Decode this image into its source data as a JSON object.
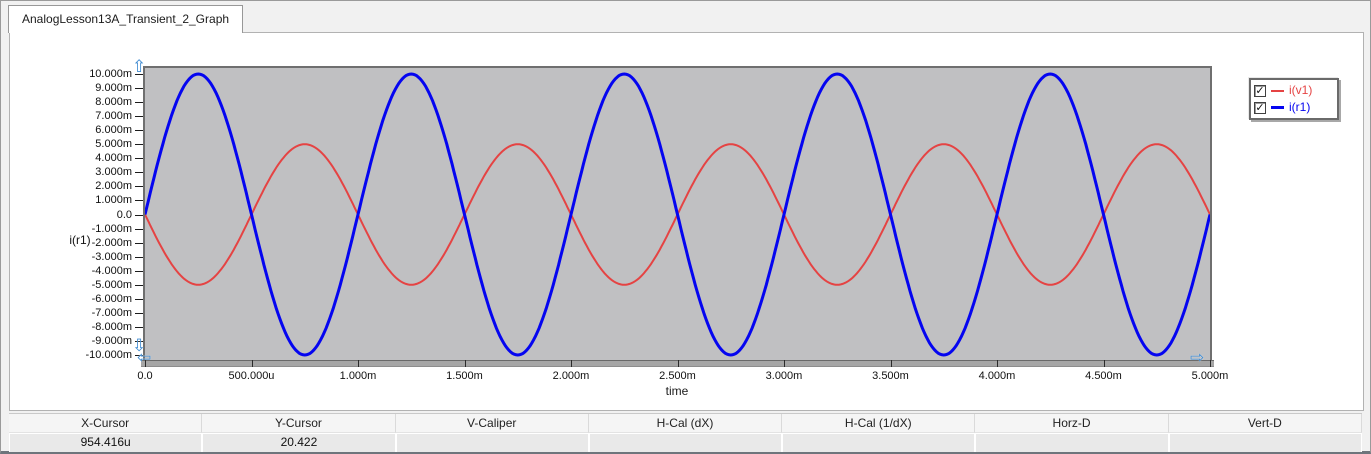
{
  "window": {
    "tab_title": "AnalogLesson13A_Transient_2_Graph"
  },
  "icons": {
    "pan_up": "⇧",
    "pan_down": "⇩",
    "pan_left": "⇦",
    "pan_right": "⇨",
    "checkmark": "✓"
  },
  "chart_data": {
    "type": "line",
    "title": "",
    "xlabel": "time",
    "ylabel": "i(r1)",
    "xlim": [
      0,
      0.005
    ],
    "ylim": [
      -0.01,
      0.01
    ],
    "grid": false,
    "plot_bg": "#c0c0c2",
    "x_ticks": [
      0,
      0.0005,
      0.001,
      0.0015,
      0.002,
      0.0025,
      0.003,
      0.0035,
      0.004,
      0.0045,
      0.005
    ],
    "x_tick_labels": [
      "0.0",
      "500.000u",
      "1.000m",
      "1.500m",
      "2.000m",
      "2.500m",
      "3.000m",
      "3.500m",
      "4.000m",
      "4.500m",
      "5.000m"
    ],
    "y_ticks": [
      0.01,
      0.009,
      0.008,
      0.007,
      0.006,
      0.005,
      0.004,
      0.003,
      0.002,
      0.001,
      0,
      -0.001,
      -0.002,
      -0.003,
      -0.004,
      -0.005,
      -0.006,
      -0.007,
      -0.008,
      -0.009,
      -0.01
    ],
    "y_tick_labels": [
      "10.000m",
      "9.000m",
      "8.000m",
      "7.000m",
      "6.000m",
      "5.000m",
      "4.000m",
      "3.000m",
      "2.000m",
      "1.000m",
      "0.0",
      "-1.000m",
      "-2.000m",
      "-3.000m",
      "-4.000m",
      "-5.000m",
      "-6.000m",
      "-7.000m",
      "-8.000m",
      "-9.000m",
      "-10.000m"
    ],
    "legend_position": "top-right",
    "series": [
      {
        "name": "i(v1)",
        "color": "#e54343",
        "stroke_width": 2,
        "waveform": "sine",
        "amplitude": 0.005,
        "period": 0.001,
        "phase_deg": 180,
        "offset": 0,
        "checked": true
      },
      {
        "name": "i(r1)",
        "color": "#0505f0",
        "stroke_width": 3,
        "waveform": "sine",
        "amplitude": 0.01,
        "period": 0.001,
        "phase_deg": 0,
        "offset": 0,
        "checked": true
      }
    ]
  },
  "status_bar": {
    "columns": [
      {
        "label": "X-Cursor",
        "value": "954.416u"
      },
      {
        "label": "Y-Cursor",
        "value": "20.422"
      },
      {
        "label": "V-Caliper",
        "value": ""
      },
      {
        "label": "H-Cal (dX)",
        "value": ""
      },
      {
        "label": "H-Cal (1/dX)",
        "value": ""
      },
      {
        "label": "Horz-D",
        "value": ""
      },
      {
        "label": "Vert-D",
        "value": ""
      }
    ]
  }
}
